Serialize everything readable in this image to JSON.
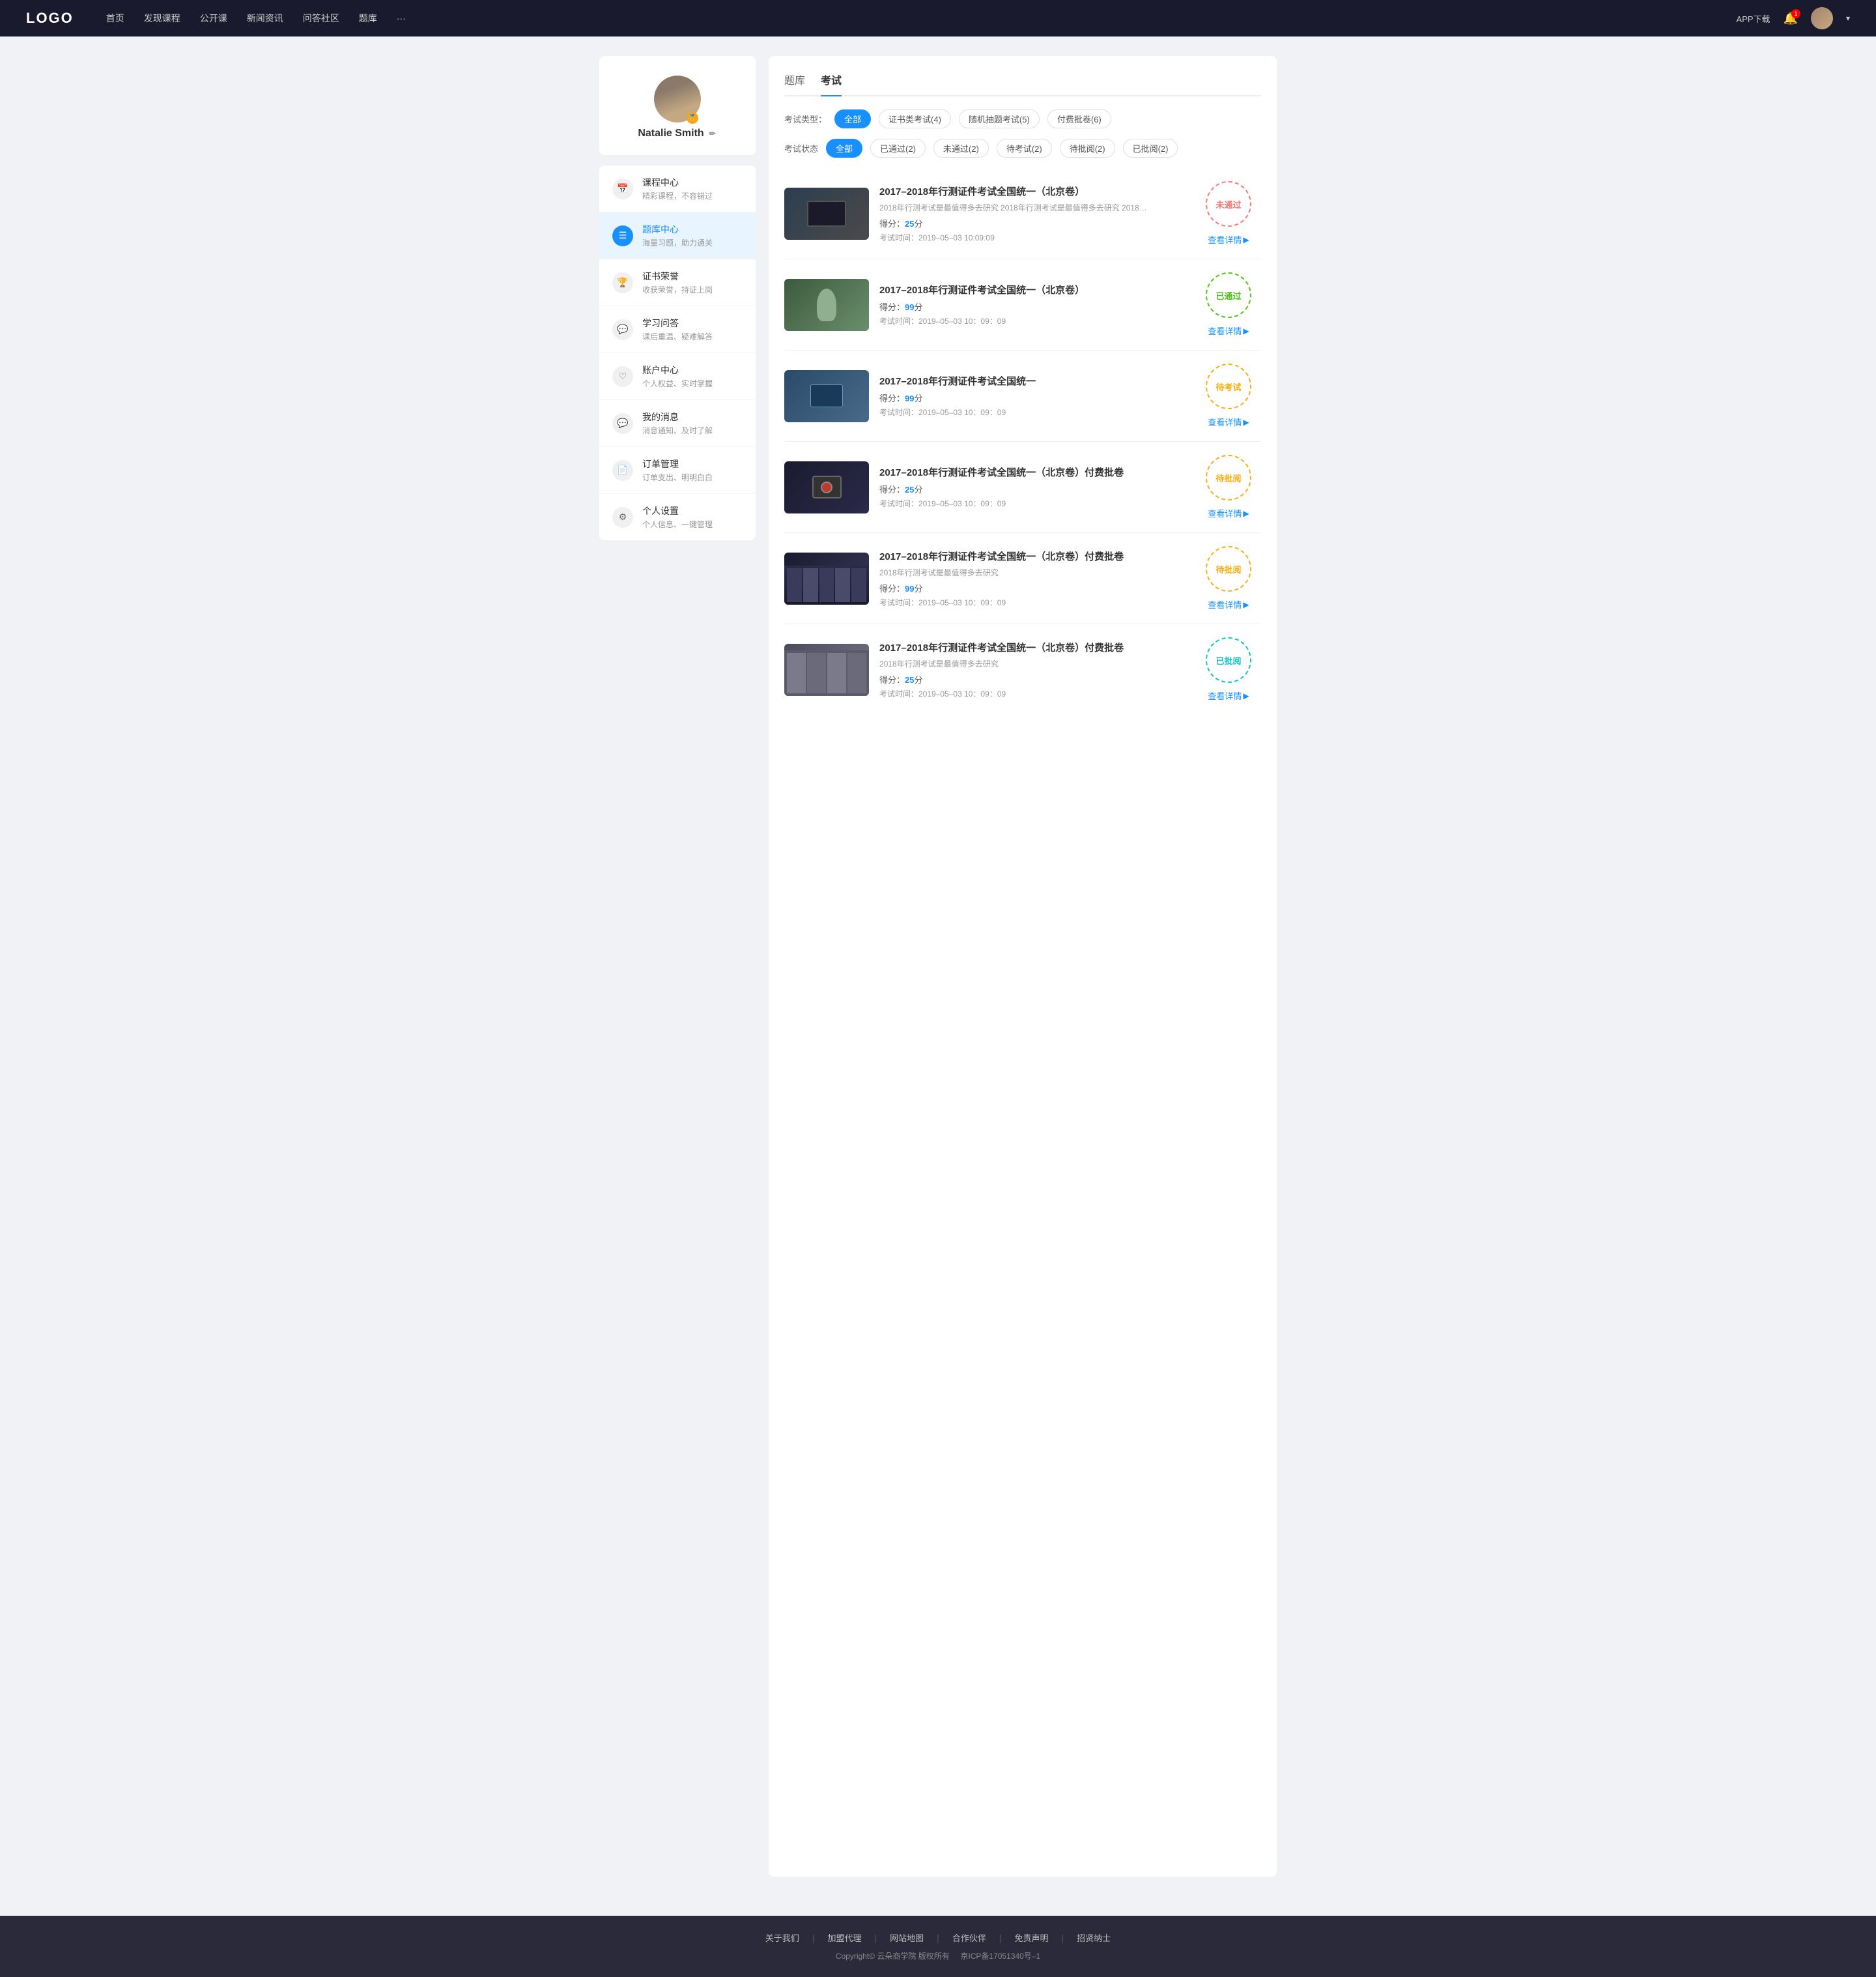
{
  "navbar": {
    "logo": "LOGO",
    "navItems": [
      {
        "label": "首页",
        "href": "#"
      },
      {
        "label": "发现课程",
        "href": "#"
      },
      {
        "label": "公开课",
        "href": "#"
      },
      {
        "label": "新闻资讯",
        "href": "#"
      },
      {
        "label": "问答社区",
        "href": "#"
      },
      {
        "label": "题库",
        "href": "#"
      },
      {
        "label": "···",
        "href": "#"
      }
    ],
    "appDownload": "APP下载",
    "bellBadge": "1",
    "dropdownIcon": "▾"
  },
  "sidebar": {
    "username": "Natalie Smith",
    "editIcon": "✏",
    "badgeIcon": "🏅",
    "menuItems": [
      {
        "id": "course-center",
        "icon": "📅",
        "title": "课程中心",
        "subtitle": "精彩课程，不容错过",
        "active": false
      },
      {
        "id": "question-bank",
        "icon": "☰",
        "title": "题库中心",
        "subtitle": "海量习题，助力通关",
        "active": true
      },
      {
        "id": "certificate",
        "icon": "👤",
        "title": "证书荣誉",
        "subtitle": "收获荣誉，持证上岗",
        "active": false
      },
      {
        "id": "qa",
        "icon": "💬",
        "title": "学习问答",
        "subtitle": "课后重温、疑难解答",
        "active": false
      },
      {
        "id": "account",
        "icon": "♡",
        "title": "账户中心",
        "subtitle": "个人权益、实时掌握",
        "active": false
      },
      {
        "id": "messages",
        "icon": "💬",
        "title": "我的消息",
        "subtitle": "消息通知、及时了解",
        "active": false
      },
      {
        "id": "orders",
        "icon": "📄",
        "title": "订单管理",
        "subtitle": "订单支出、明明白白",
        "active": false
      },
      {
        "id": "settings",
        "icon": "⚙",
        "title": "个人设置",
        "subtitle": "个人信息、一键管理",
        "active": false
      }
    ]
  },
  "main": {
    "tabs": [
      {
        "label": "题库",
        "active": false
      },
      {
        "label": "考试",
        "active": true
      }
    ],
    "typeFilter": {
      "label": "考试类型：",
      "options": [
        {
          "label": "全部",
          "active": true
        },
        {
          "label": "证书类考试(4)",
          "active": false
        },
        {
          "label": "随机抽题考试(5)",
          "active": false
        },
        {
          "label": "付费批卷(6)",
          "active": false
        }
      ]
    },
    "statusFilter": {
      "label": "考试状态",
      "options": [
        {
          "label": "全部",
          "active": true
        },
        {
          "label": "已通过(2)",
          "active": false
        },
        {
          "label": "未通过(2)",
          "active": false
        },
        {
          "label": "待考试(2)",
          "active": false
        },
        {
          "label": "待批阅(2)",
          "active": false
        },
        {
          "label": "已批阅(2)",
          "active": false
        }
      ]
    },
    "examItems": [
      {
        "id": 1,
        "title": "2017–2018年行测证件考试全国统一（北京卷）",
        "desc": "2018年行测考试是最值得多去研究 2018年行测考试是最值得多去研究 2018年行...",
        "score": "25",
        "time": "2019–05–03  10:09:09",
        "status": "未通过",
        "statusClass": "badge-failed",
        "thumbClass": "thumb-1",
        "detailLabel": "查看详情"
      },
      {
        "id": 2,
        "title": "2017–2018年行测证件考试全国统一（北京卷）",
        "desc": "",
        "score": "99",
        "time": "2019–05–03  10：09：09",
        "status": "已通过",
        "statusClass": "badge-passed",
        "thumbClass": "thumb-2",
        "detailLabel": "查看详情"
      },
      {
        "id": 3,
        "title": "2017–2018年行测证件考试全国统一",
        "desc": "",
        "score": "99",
        "time": "2019–05–03  10：09：09",
        "status": "待考试",
        "statusClass": "badge-pending",
        "thumbClass": "thumb-3",
        "detailLabel": "查看详情"
      },
      {
        "id": 4,
        "title": "2017–2018年行测证件考试全国统一（北京卷）付费批卷",
        "desc": "",
        "score": "25",
        "time": "2019–05–03  10：09：09",
        "status": "待批阅",
        "statusClass": "badge-pending",
        "thumbClass": "thumb-4",
        "detailLabel": "查看详情"
      },
      {
        "id": 5,
        "title": "2017–2018年行测证件考试全国统一（北京卷）付费批卷",
        "desc": "2018年行测考试是最值得多去研究",
        "score": "99",
        "time": "2019–05–03  10：09：09",
        "status": "待批阅",
        "statusClass": "badge-pending",
        "thumbClass": "thumb-5",
        "detailLabel": "查看详情"
      },
      {
        "id": 6,
        "title": "2017–2018年行测证件考试全国统一（北京卷）付费批卷",
        "desc": "2018年行测考试是最值得多去研究",
        "score": "25",
        "time": "2019–05–03  10：09：09",
        "status": "已批阅",
        "statusClass": "badge-reviewed",
        "thumbClass": "thumb-6",
        "detailLabel": "查看详情"
      }
    ]
  },
  "footer": {
    "links": [
      "关于我们",
      "加盟代理",
      "网站地图",
      "合作伙伴",
      "免责声明",
      "招贤纳士"
    ],
    "copyright": "Copyright© 云朵商学院  版权所有",
    "icp": "京ICP备17051340号–1"
  }
}
